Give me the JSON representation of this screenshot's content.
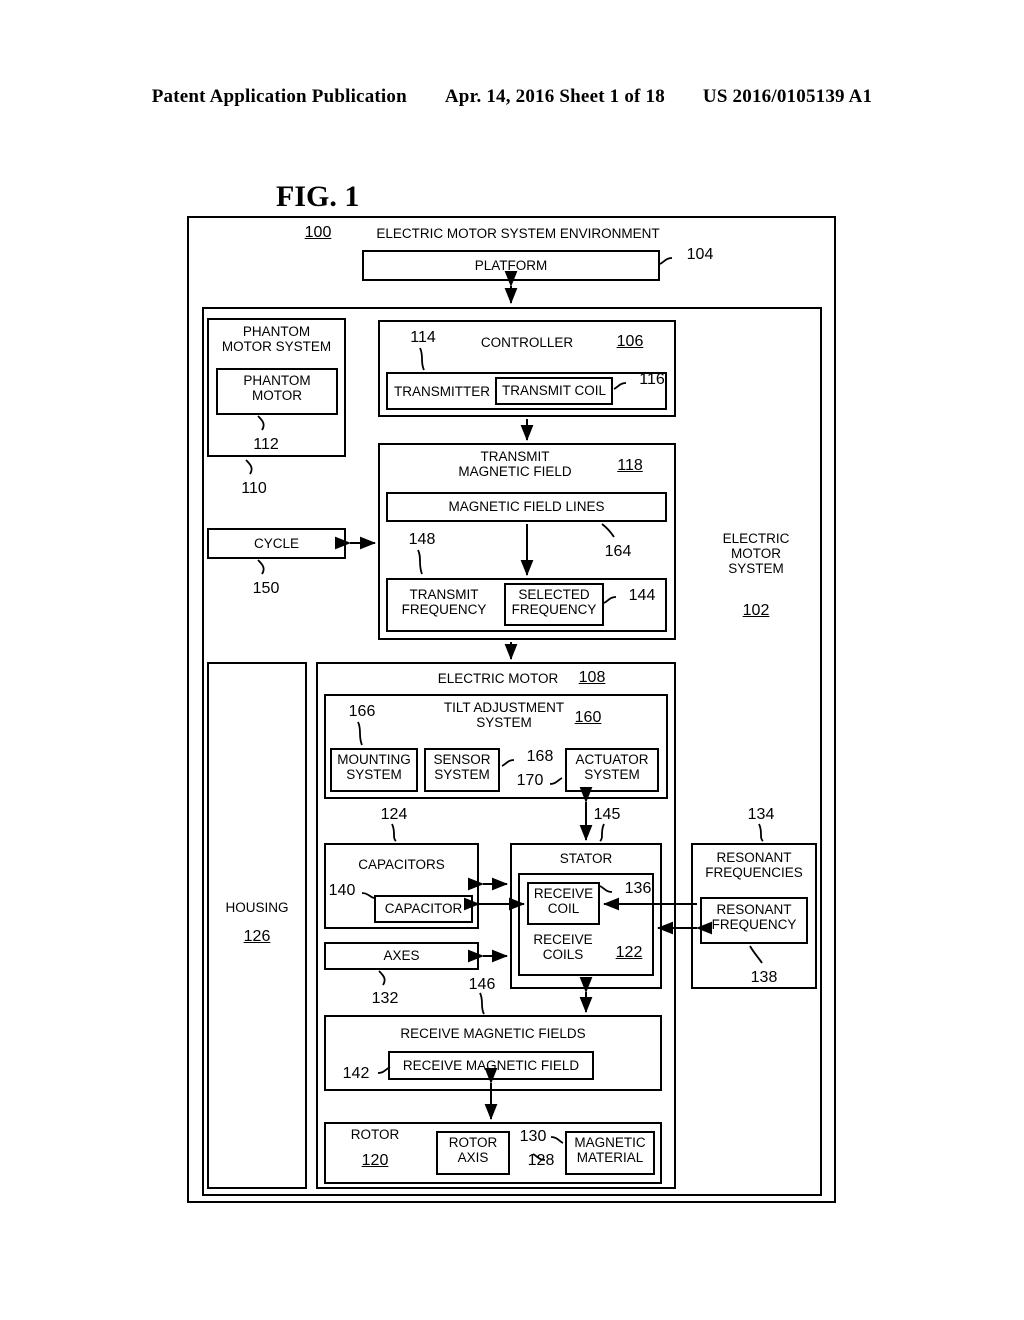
{
  "header": {
    "publication": "Patent Application Publication",
    "date_sheet": "Apr. 14, 2016  Sheet 1 of 18",
    "patent_number": "US 2016/0105139 A1"
  },
  "figure": {
    "label": "FIG. 1"
  },
  "diagram": {
    "environment": {
      "title": "ELECTRIC MOTOR SYSTEM ENVIRONMENT",
      "ref": "100"
    },
    "platform": {
      "label": "PLATFORM",
      "ref": "104"
    },
    "electric_motor_system": {
      "label_l1": "ELECTRIC",
      "label_l2": "MOTOR",
      "label_l3": "SYSTEM",
      "ref": "102"
    },
    "phantom_motor_system": {
      "label_l1": "PHANTOM",
      "label_l2": "MOTOR SYSTEM",
      "ref": "110"
    },
    "phantom_motor": {
      "label_l1": "PHANTOM",
      "label_l2": "MOTOR",
      "ref": "112"
    },
    "controller": {
      "label": "CONTROLLER",
      "ref": "106"
    },
    "transmitter": {
      "label": "TRANSMITTER",
      "ref": "114"
    },
    "transmit_coil": {
      "label": "TRANSMIT COIL",
      "ref": "116"
    },
    "transmit_magnetic_field": {
      "label_l1": "TRANSMIT",
      "label_l2": "MAGNETIC FIELD",
      "ref": "118"
    },
    "magnetic_field_lines": {
      "label": "MAGNETIC FIELD LINES",
      "ref": "164"
    },
    "transmit_frequency": {
      "label_l1": "TRANSMIT",
      "label_l2": "FREQUENCY",
      "ref": "148"
    },
    "selected_frequency": {
      "label_l1": "SELECTED",
      "label_l2": "FREQUENCY",
      "ref": "144"
    },
    "cycle": {
      "label": "CYCLE",
      "ref": "150"
    },
    "housing": {
      "label": "HOUSING",
      "ref": "126"
    },
    "electric_motor": {
      "label": "ELECTRIC MOTOR",
      "ref": "108"
    },
    "tilt_adjustment_system": {
      "label_l1": "TILT ADJUSTMENT",
      "label_l2": "SYSTEM",
      "ref": "160"
    },
    "mounting_system": {
      "label_l1": "MOUNTING",
      "label_l2": "SYSTEM",
      "ref": "166"
    },
    "sensor_system": {
      "label_l1": "SENSOR",
      "label_l2": "SYSTEM",
      "ref": "168"
    },
    "actuator_system": {
      "label_l1": "ACTUATOR",
      "label_l2": "SYSTEM",
      "ref": "170"
    },
    "capacitors": {
      "label": "CAPACITORS",
      "ref": "124"
    },
    "capacitor": {
      "label": "CAPACITOR",
      "ref": "140"
    },
    "axes": {
      "label": "AXES",
      "ref": "132"
    },
    "stator": {
      "label": "STATOR",
      "ref": "145"
    },
    "receive_coils": {
      "label_l1": "RECEIVE",
      "label_l2": "COILS",
      "ref": "122"
    },
    "receive_coil": {
      "label_l1": "RECEIVE",
      "label_l2": "COIL",
      "ref": "136"
    },
    "resonant_frequencies": {
      "label_l1": "RESONANT",
      "label_l2": "FREQUENCIES",
      "ref": "134"
    },
    "resonant_frequency": {
      "label_l1": "RESONANT",
      "label_l2": "FREQUENCY",
      "ref": "138"
    },
    "receive_magnetic_fields": {
      "label": "RECEIVE MAGNETIC FIELDS",
      "ref": "146"
    },
    "receive_magnetic_field": {
      "label": "RECEIVE MAGNETIC FIELD",
      "ref": "142"
    },
    "rotor": {
      "label": "ROTOR",
      "ref": "120"
    },
    "rotor_axis": {
      "label_l1": "ROTOR",
      "label_l2": "AXIS",
      "ref": "128"
    },
    "magnetic_material": {
      "label_l1": "MAGNETIC",
      "label_l2": "MATERIAL",
      "ref": "130"
    }
  }
}
